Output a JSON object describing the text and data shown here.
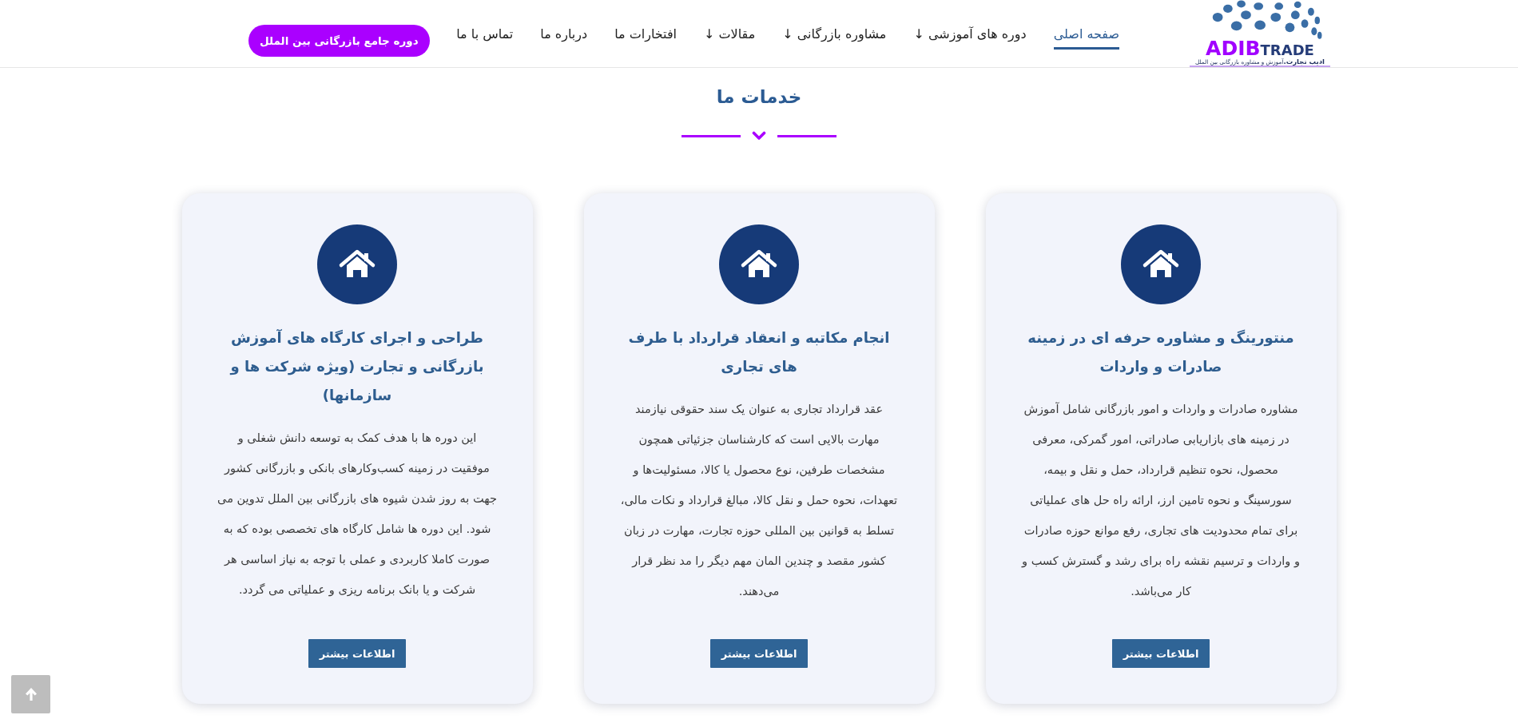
{
  "header": {
    "logo": {
      "word_a": "ADIB",
      "word_b": "TRADE",
      "tagline": "**ادیب تجارت.**آموزش و مشاوره بازرگانی بین الملل"
    },
    "nav": [
      {
        "label": "صفحه اصلی",
        "selected": true
      },
      {
        "label": "دوره های آموزشی ↓",
        "selected": false
      },
      {
        "label": "مشاوره بازرگانی ↓",
        "selected": false
      },
      {
        "label": "مقالات ↓",
        "selected": false
      },
      {
        "label": "افتخارات ما",
        "selected": false
      },
      {
        "label": "درباره ما",
        "selected": false
      },
      {
        "label": "تماس با ما",
        "selected": false
      }
    ],
    "cta_button": "دوره جامع بازرگانی بین الملل"
  },
  "services": {
    "title": "خدمات ما",
    "cards": [
      {
        "title": "منتورینگ و مشاوره حرفه ای در زمینه صادرات و واردات",
        "text": "مشاوره صادرات و واردات و امور بازرگانی شامل آموزش در زمینه های بازاریابی صادراتی، امور گمرکی، معرفی محصول، نحوه تنظیم قرارداد، حمل و نقل و بیمه، سورسینگ و نحوه تامین ارز، ارائه راه حل های عملیاتی برای تمام محدودیت های تجاری، رفع موانع حوزه صادرات و واردات و ترسیم نقشه راه برای رشد و گسترش کسب و کار می‌باشد.",
        "button": "اطلاعات بیشتر"
      },
      {
        "title": "انجام مکاتبه و انعقاد قرارداد با طرف های تجاری",
        "text": "عقد قرارداد تجاری به عنوان یک سند حقوقی نیازمند مهارت بالایی است که کارشناسان جزئیاتی همچون مشخصات طرفین، نوع محصول یا کالا، مسئولیت‌ها و تعهدات، نحوه حمل و نقل کالا، مبالغ قرارداد و نکات مالی، تسلط به قوانین بین المللی حوزه تجارت، مهارت در زبان کشور مقصد و چندین المان مهم دیگر را مد نظر قرار می‌دهند.",
        "button": "اطلاعات بیشتر"
      },
      {
        "title": "طراحی و اجرای کارگاه های آموزش بازرگانی و تجارت (ویژه شرکت ها و سازمانها)",
        "text": "این دوره ها با هدف کمک به توسعه دانش شغلی و موفقیت در زمینه کسب‌وکارهای بانکی و بازرگانی کشور جهت به روز شدن شیوه های بازرگانی بین الملل تدوین می شود. این دوره ها شامل کارگاه های تخصصی بوده که به صورت کاملا کاربردی و عملی با توجه به نیاز اساسی هر شرکت و یا بانک برنامه ریزی و عملیاتی می گردد.",
        "button": "اطلاعات بیشتر"
      }
    ]
  }
}
